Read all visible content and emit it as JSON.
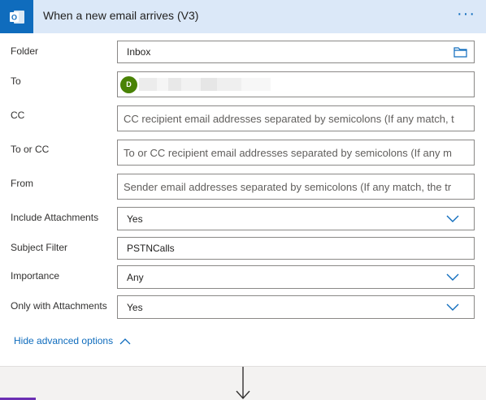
{
  "header": {
    "title": "When a new email arrives (V3)",
    "icon": "outlook-icon",
    "more_label": "···",
    "accent": "#0f6cbd"
  },
  "fields": {
    "folder": {
      "label": "Folder",
      "value": "Inbox"
    },
    "to": {
      "label": "To",
      "avatar_initial": "D"
    },
    "cc": {
      "label": "CC",
      "placeholder": "CC recipient email addresses separated by semicolons (If any match, t"
    },
    "to_or_cc": {
      "label": "To or CC",
      "placeholder": "To or CC recipient email addresses separated by semicolons (If any m"
    },
    "from": {
      "label": "From",
      "placeholder": "Sender email addresses separated by semicolons (If any match, the tr"
    },
    "include_attachments": {
      "label": "Include Attachments",
      "value": "Yes"
    },
    "subject_filter": {
      "label": "Subject Filter",
      "value": "PSTNCalls"
    },
    "importance": {
      "label": "Importance",
      "value": "Any"
    },
    "only_with_attachments": {
      "label": "Only with Attachments",
      "value": "Yes"
    }
  },
  "advanced": {
    "label": "Hide advanced options"
  }
}
